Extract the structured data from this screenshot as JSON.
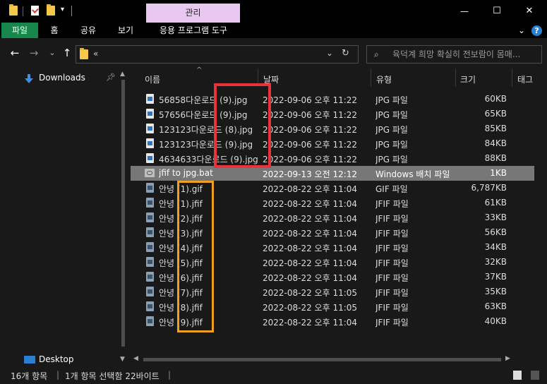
{
  "titlebar": {
    "manage_tab": "관리",
    "min": "—",
    "max": "☐",
    "close": "✕"
  },
  "ribbon": {
    "tabs": [
      "파일",
      "홈",
      "공유",
      "보기",
      "응용 프로그램 도구"
    ]
  },
  "address": {
    "path": "«",
    "search_placeholder": "육덕계 희망 확실히 전보람이 몸매..."
  },
  "sidebar": {
    "items": [
      {
        "label": "Downloads",
        "icon": "download-arrow-icon"
      },
      {
        "label": "Desktop",
        "icon": "desktop-icon"
      }
    ]
  },
  "columns": [
    "이름",
    "날짜",
    "유형",
    "크기",
    "태그"
  ],
  "files": [
    {
      "name": "56858다운로드 (9).jpg",
      "date": "2022-09-06 오후 11:22",
      "type": "JPG 파일",
      "size": "60KB",
      "icon": "jpg"
    },
    {
      "name": "57656다운로드 (9).jpg",
      "date": "2022-09-06 오후 11:22",
      "type": "JPG 파일",
      "size": "65KB",
      "icon": "jpg"
    },
    {
      "name": "123123다운로드 (8).jpg",
      "date": "2022-09-06 오후 11:22",
      "type": "JPG 파일",
      "size": "85KB",
      "icon": "jpg"
    },
    {
      "name": "123123다운로드 (9).jpg",
      "date": "2022-09-06 오후 11:22",
      "type": "JPG 파일",
      "size": "84KB",
      "icon": "jpg"
    },
    {
      "name": "4634633다운로드 (9).jpg",
      "date": "2022-09-06 오후 11:22",
      "type": "JPG 파일",
      "size": "88KB",
      "icon": "jpg"
    },
    {
      "name": "jfif to jpg.bat",
      "date": "2022-09-13 오전 12:12",
      "type": "Windows 배치 파일",
      "size": "1KB",
      "icon": "bat",
      "selected": true
    },
    {
      "name": "안녕 (1).gif",
      "date": "2022-08-22 오후 11:04",
      "type": "GIF 파일",
      "size": "6,787KB",
      "icon": "jfif"
    },
    {
      "name": "안녕 (1).jfif",
      "date": "2022-08-22 오후 11:04",
      "type": "JFIF 파일",
      "size": "61KB",
      "icon": "jfif"
    },
    {
      "name": "안녕 (2).jfif",
      "date": "2022-08-22 오후 11:04",
      "type": "JFIF 파일",
      "size": "33KB",
      "icon": "jfif"
    },
    {
      "name": "안녕 (3).jfif",
      "date": "2022-08-22 오후 11:04",
      "type": "JFIF 파일",
      "size": "56KB",
      "icon": "jfif"
    },
    {
      "name": "안녕 (4).jfif",
      "date": "2022-08-22 오후 11:04",
      "type": "JFIF 파일",
      "size": "34KB",
      "icon": "jfif"
    },
    {
      "name": "안녕 (5).jfif",
      "date": "2022-08-22 오후 11:04",
      "type": "JFIF 파일",
      "size": "32KB",
      "icon": "jfif"
    },
    {
      "name": "안녕 (6).jfif",
      "date": "2022-08-22 오후 11:04",
      "type": "JFIF 파일",
      "size": "37KB",
      "icon": "jfif"
    },
    {
      "name": "안녕 (7).jfif",
      "date": "2022-08-22 오후 11:05",
      "type": "JFIF 파일",
      "size": "35KB",
      "icon": "jfif"
    },
    {
      "name": "안녕 (8).jfif",
      "date": "2022-08-22 오후 11:05",
      "type": "JFIF 파일",
      "size": "63KB",
      "icon": "jfif"
    },
    {
      "name": "안녕 (9).jfif",
      "date": "2022-08-22 오후 11:04",
      "type": "JFIF 파일",
      "size": "40KB",
      "icon": "jfif"
    }
  ],
  "status": {
    "count": "16개 항목",
    "selection": "1개 항목 선택함 22바이트"
  },
  "colors": {
    "file_tab": "#17874b",
    "manage_tab": "#e8c8f0",
    "selected_row": "#777777",
    "annotation_red": "#e8333a",
    "annotation_orange": "#f0a020"
  }
}
